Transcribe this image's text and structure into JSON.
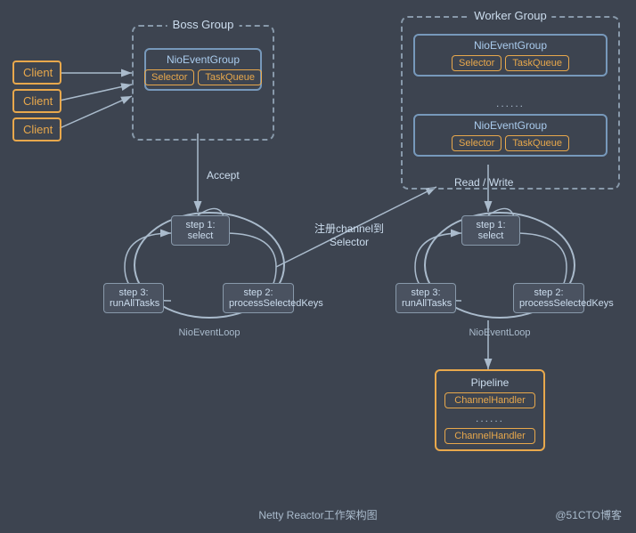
{
  "clients": [
    {
      "label": "Client"
    },
    {
      "label": "Client"
    },
    {
      "label": "Client"
    }
  ],
  "bossGroup": {
    "title": "Boss Group",
    "nioEventGroup": {
      "label": "NioEventGroup",
      "selector": "Selector",
      "taskQueue": "TaskQueue"
    }
  },
  "workerGroup": {
    "title": "Worker Group",
    "nioEventGroups": [
      {
        "label": "NioEventGroup",
        "selector": "Selector",
        "taskQueue": "TaskQueue"
      },
      {
        "label": "NioEventGroup",
        "selector": "Selector",
        "taskQueue": "TaskQueue"
      }
    ],
    "dots": "......"
  },
  "bossLoop": {
    "label": "NioEventLoop",
    "step1": "step 1:\nselect",
    "step2": "step 2:\nprocessSelectedKeys",
    "step3": "step 3:\nrunAllTasks"
  },
  "workerLoop": {
    "label": "NioEventLoop",
    "step1": "step 1:\nselect",
    "step2": "step 2:\nprocessSelectedKeys",
    "step3": "step 3:\nrunAllTasks"
  },
  "labels": {
    "accept": "Accept",
    "registerChannel": "注册channel到\nSelector",
    "readWrite": "Read / Write"
  },
  "pipeline": {
    "label": "Pipeline",
    "channelHandler": "ChannelHandler",
    "dots": "......",
    "channelHandler2": "ChannelHandler"
  },
  "footer": {
    "center": "Netty Reactor工作架构图",
    "right": "@51CTO博客"
  }
}
